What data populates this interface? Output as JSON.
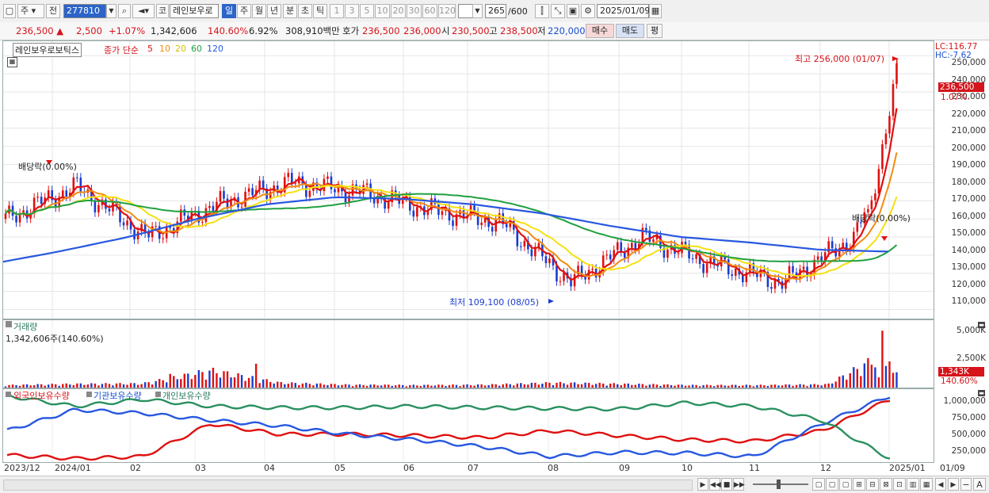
{
  "toolbar": {
    "market_label": "주",
    "prev_label": "전",
    "code": "277810",
    "kind_label": "코",
    "name": "레인보우로",
    "periods": [
      "일",
      "주",
      "월",
      "년",
      "분",
      "초",
      "틱"
    ],
    "intervals": [
      "1",
      "3",
      "5",
      "10",
      "20",
      "30",
      "60",
      "120"
    ],
    "count": "265",
    "count_total": "/600",
    "date": "2025/01/09"
  },
  "quote": {
    "price": "236,500",
    "change": "2,500",
    "change_pct": "+1.07%",
    "volume": "1,342,606",
    "volume_ratio": "140.60%",
    "turnover_pct": "6.92%",
    "amount": "308,910백만",
    "hoga_label": "호가",
    "ask": "236,500",
    "bid": "236,000",
    "open_label": "시",
    "open": "230,500",
    "high_label": "고",
    "high": "238,500",
    "low_label": "저",
    "low": "220,000",
    "buy_label": "매수",
    "sell_label": "매도",
    "eval_label": "평"
  },
  "price_panel": {
    "stock_name": "레인보우로보틱스",
    "ma_title": "종가 단순",
    "ma_periods": [
      "5",
      "10",
      "20",
      "60",
      "120"
    ],
    "lc": "LC:116.77",
    "hc": "HC:-7.62",
    "last_price": "236,500",
    "last_pct": "1.07%",
    "high_note": "최고 256,000 (01/07)",
    "low_note": "최저 109,100 (08/05)",
    "dividend_left": "배당락(0.00%)",
    "dividend_right": "배당락(0.00%)",
    "y_ticks": [
      "250,000",
      "240,000",
      "230,000",
      "220,000",
      "210,000",
      "200,000",
      "190,000",
      "180,000",
      "170,000",
      "160,000",
      "150,000",
      "140,000",
      "130,000",
      "120,000",
      "110,000"
    ]
  },
  "volume_panel": {
    "title": "거래량",
    "value": "1,342,606주(140.60%)",
    "y_ticks": [
      "5,000K",
      "2,500K"
    ],
    "last": "1,343K",
    "last_pct": "140.60%"
  },
  "holdings_panel": {
    "series": [
      "외국인보유수량",
      "기관보유수량",
      "개인보유수량"
    ],
    "y_ticks": [
      "1,000,000",
      "750,000",
      "500,000",
      "250,000"
    ]
  },
  "x_axis": [
    "2023/12",
    "2024/01",
    "02",
    "03",
    "04",
    "05",
    "06",
    "07",
    "08",
    "09",
    "10",
    "11",
    "12",
    "2025/01",
    "01/09"
  ],
  "colors": {
    "ma5": "#e01010",
    "ma10": "#f08c10",
    "ma20": "#f5e010",
    "ma60": "#20a040",
    "ma120": "#2858e0",
    "up": "#e01010",
    "down": "#1a3cd0"
  },
  "chart_data": [
    {
      "type": "line",
      "title": "레인보우로보틱스",
      "note": "daily price candles with moving averages",
      "x": [
        "2023/12",
        "2024/01",
        "02",
        "03",
        "04",
        "05",
        "06",
        "07",
        "08",
        "09",
        "10",
        "11",
        "12",
        "2025/01"
      ],
      "series": [
        {
          "name": "종가",
          "values": [
            160000,
            178000,
            150000,
            168000,
            180000,
            175000,
            165000,
            158000,
            125000,
            150000,
            135000,
            125000,
            150000,
            236500
          ]
        },
        {
          "name": "120",
          "values": [
            135000,
            142000,
            150000,
            160000,
            168000,
            172000,
            171000,
            168000,
            163000,
            156000,
            150000,
            147000,
            143000,
            142000
          ]
        }
      ],
      "ylim": [
        105000,
        258000
      ],
      "extremes": {
        "high": 256000,
        "low": 109100
      }
    },
    {
      "type": "bar",
      "title": "거래량",
      "categories": [
        "2023/12",
        "2024/01",
        "02",
        "03",
        "04",
        "05",
        "06",
        "07",
        "08",
        "09",
        "10",
        "11",
        "12",
        "2025/01"
      ],
      "values": [
        300,
        450,
        500,
        2100,
        600,
        350,
        300,
        350,
        600,
        450,
        300,
        300,
        400,
        5000
      ],
      "unit": "K"
    },
    {
      "type": "line",
      "title": "보유수량",
      "x": [
        "2023/12",
        "2024/01",
        "02",
        "03",
        "04",
        "05",
        "06",
        "07",
        "08",
        "09",
        "10",
        "11",
        "12",
        "2025/01"
      ],
      "series": [
        {
          "name": "외국인보유수량",
          "values": [
            200000,
            150000,
            180000,
            650000,
            500000,
            500000,
            480000,
            450000,
            550000,
            480000,
            420000,
            400000,
            550000,
            1000000
          ]
        },
        {
          "name": "기관보유수량",
          "values": [
            550000,
            850000,
            800000,
            700000,
            620000,
            500000,
            420000,
            320000,
            180000,
            240000,
            230000,
            180000,
            650000,
            1050000
          ]
        },
        {
          "name": "개인보유수량",
          "values": [
            1050000,
            900000,
            1000000,
            900000,
            880000,
            880000,
            900000,
            880000,
            870000,
            860000,
            950000,
            900000,
            700000,
            150000
          ]
        }
      ],
      "ylim": [
        100000,
        1100000
      ]
    }
  ]
}
